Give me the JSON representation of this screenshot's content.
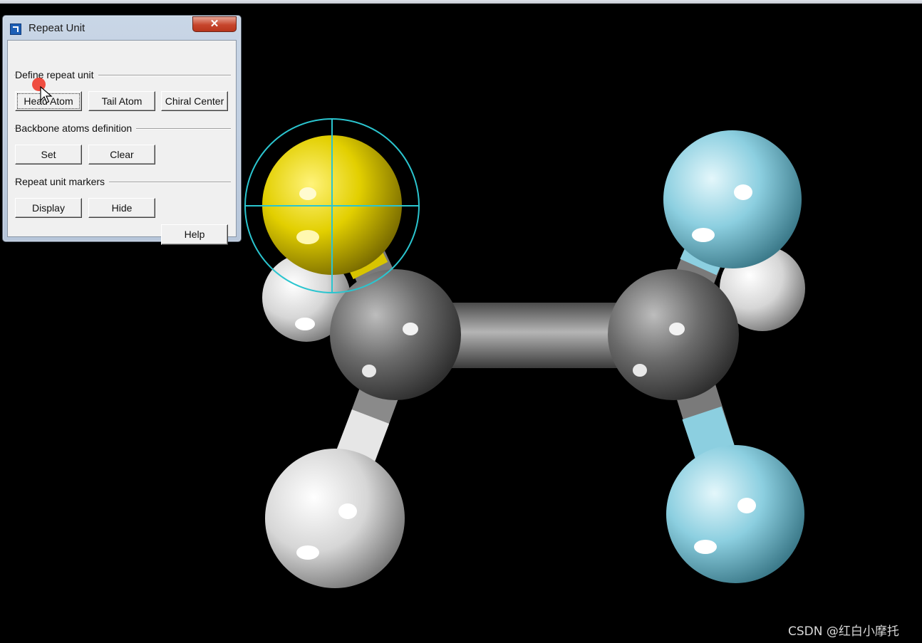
{
  "dialog": {
    "title": "Repeat Unit",
    "close_glyph": "✕",
    "groups": [
      {
        "label": "Define repeat unit",
        "buttons": [
          "Head Atom",
          "Tail Atom",
          "Chiral Center"
        ]
      },
      {
        "label": "Backbone atoms definition",
        "buttons": [
          "Set",
          "Clear"
        ]
      },
      {
        "label": "Repeat unit markers",
        "buttons": [
          "Display",
          "Hide"
        ]
      }
    ],
    "help_label": "Help"
  },
  "molecule": {
    "atoms": [
      {
        "element": "C",
        "color": "#6e6e6e"
      },
      {
        "element": "C",
        "color": "#6e6e6e"
      },
      {
        "element": "S",
        "color": "#e6d600",
        "selected": true
      },
      {
        "element": "H",
        "color": "#e8e8e8"
      },
      {
        "element": "H",
        "color": "#e8e8e8"
      },
      {
        "element": "H",
        "color": "#e8e8e8"
      },
      {
        "element": "F",
        "color": "#8ccfe0"
      },
      {
        "element": "F",
        "color": "#8ccfe0"
      }
    ]
  },
  "watermark": "CSDN @红白小摩托"
}
